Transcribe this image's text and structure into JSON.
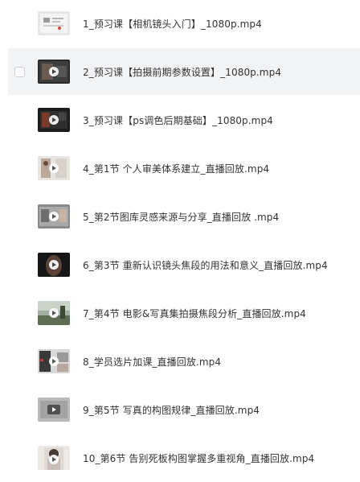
{
  "files": [
    {
      "name": "1_预习课【相机镜头入门】_1080p.mp4",
      "thumb_style": "doc-light",
      "play_icon": false
    },
    {
      "name": "2_预习课【拍摄前期参数设置】_1080p.mp4",
      "thumb_style": "dark-screen",
      "play_icon": true
    },
    {
      "name": "3_预习课【ps调色后期基础】_1080p.mp4",
      "thumb_style": "dark-screen-red",
      "play_icon": true
    },
    {
      "name": "4_第1节 个人审美体系建立_直播回放.mp4",
      "thumb_style": "portrait-light",
      "play_icon": true
    },
    {
      "name": "5_第2节图库灵感来源与分享_直播回放 .mp4",
      "thumb_style": "screen-grey",
      "play_icon": true
    },
    {
      "name": "6_第3节 重新认识镜头焦段的用法和意义_直播回放.mp4",
      "thumb_style": "portrait-dark",
      "play_icon": true
    },
    {
      "name": "7_第4节 电影&写真集拍摄焦段分析_直播回放.mp4",
      "thumb_style": "landscape",
      "play_icon": true
    },
    {
      "name": "8_学员选片加课_直播回放.mp4",
      "thumb_style": "mixed",
      "play_icon": true
    },
    {
      "name": "9_第5节 写真的构图规律_直播回放.mp4",
      "thumb_style": "grey",
      "play_icon": true
    },
    {
      "name": "10_第6节 告别死板构图掌握多重视角_直播回放.mp4",
      "thumb_style": "portrait-pale",
      "play_icon": true
    }
  ],
  "colors": {
    "text": "#333333",
    "row_hover_bg": "#f2f3f5",
    "checkbox_border": "#c9cdd4"
  },
  "hovered_row": 1
}
